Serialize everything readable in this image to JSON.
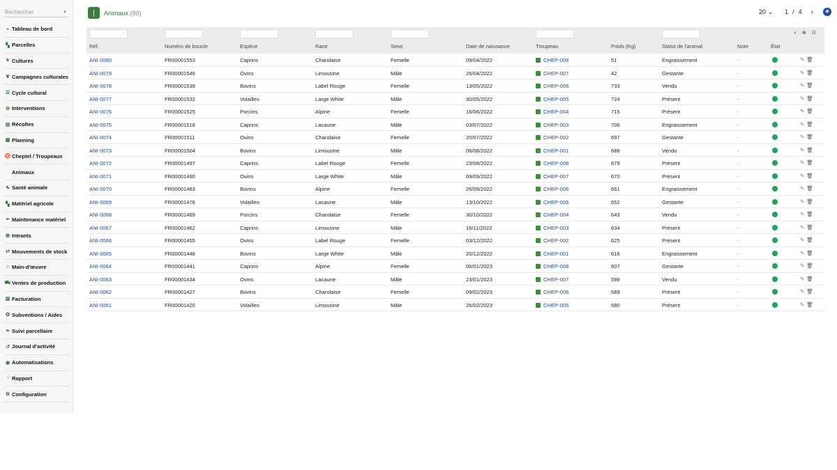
{
  "search": {
    "placeholder": "Rechercher"
  },
  "sidebar": {
    "items": [
      {
        "label": "Tableau de bord",
        "icon": "dashboard-icon",
        "glyph": "◒",
        "sub": false
      },
      {
        "label": "Parcelles",
        "icon": "tractor-icon",
        "glyph": "▚",
        "sub": false
      },
      {
        "label": "Cultures",
        "icon": "sprout-icon",
        "glyph": "⚘",
        "sub": false
      },
      {
        "label": "Campagnes culturales",
        "icon": "leaf-icon",
        "glyph": "❦",
        "sub": false
      },
      {
        "label": "Cycle cultural",
        "icon": "list-icon",
        "glyph": "☰",
        "sub": false
      },
      {
        "label": "Interventions",
        "icon": "bike-icon",
        "glyph": "⚙",
        "sub": false
      },
      {
        "label": "Récoltes",
        "icon": "basket-icon",
        "glyph": "▤",
        "sub": false
      },
      {
        "label": "Planning",
        "icon": "calendar-icon",
        "glyph": "▦",
        "sub": false
      },
      {
        "label": "Cheptel / Troupeaux",
        "icon": "cow-icon",
        "glyph": "♉",
        "sub": false
      },
      {
        "label": "Animaux",
        "icon": "",
        "glyph": "",
        "sub": true
      },
      {
        "label": "Santé animale",
        "icon": "syringe-icon",
        "glyph": "✎",
        "sub": false
      },
      {
        "label": "Matériel agricole",
        "icon": "tractor-icon",
        "glyph": "▚",
        "sub": false
      },
      {
        "label": "Maintenance matériel",
        "icon": "wrench-icon",
        "glyph": "✒",
        "sub": false
      },
      {
        "label": "Intrants",
        "icon": "sack-icon",
        "glyph": "◍",
        "sub": false
      },
      {
        "label": "Mouvements de stock",
        "icon": "exchange-icon",
        "glyph": "⇄",
        "sub": false
      },
      {
        "label": "Main-d'œuvre",
        "icon": "user-icon",
        "glyph": "☺",
        "sub": false
      },
      {
        "label": "Ventes de production",
        "icon": "truck-icon",
        "glyph": "⛟",
        "sub": false
      },
      {
        "label": "Facturation",
        "icon": "invoice-icon",
        "glyph": "▥",
        "sub": false
      },
      {
        "label": "Subventions / Aides",
        "icon": "award-icon",
        "glyph": "✪",
        "sub": false
      },
      {
        "label": "Suivi parcellaire",
        "icon": "map-icon",
        "glyph": "❧",
        "sub": false
      },
      {
        "label": "Journal d'activité",
        "icon": "history-icon",
        "glyph": "↺",
        "sub": false
      },
      {
        "label": "Automatisations",
        "icon": "robot-icon",
        "glyph": "◉",
        "sub": false
      },
      {
        "label": "Rapport",
        "icon": "chart-pie-icon",
        "glyph": "◔",
        "sub": false
      },
      {
        "label": "Configuration",
        "icon": "gear-icon",
        "glyph": "⚙",
        "sub": false
      }
    ]
  },
  "header": {
    "title": "Animaux",
    "count": "(80)"
  },
  "pager": {
    "page_size": "20",
    "current": "1",
    "sep": "/",
    "total": "4"
  },
  "table": {
    "columns": [
      "Réf.",
      "Numéro de boucle",
      "Espèce",
      "Race",
      "Sexe",
      "Date de naissance",
      "Troupeau",
      "Poids (Kg)",
      "Statut de l'animal",
      "Note",
      "État"
    ],
    "rows": [
      [
        "ANI-0080",
        "FR00001553",
        "Caprins",
        "Charolaise",
        "Femelle",
        "09/04/2022",
        "CHEP-008",
        "51",
        "Engraissement",
        "-"
      ],
      [
        "ANI-0079",
        "FR00001546",
        "Ovins",
        "Limousine",
        "Mâle",
        "26/04/2022",
        "CHEP-007",
        "42",
        "Gestante",
        "-"
      ],
      [
        "ANI-0078",
        "FR00001539",
        "Bovins",
        "Label Rouge",
        "Femelle",
        "13/05/2022",
        "CHEP-006",
        "733",
        "Vendu",
        "-"
      ],
      [
        "ANI-0077",
        "FR00001532",
        "Volailles",
        "Large White",
        "Mâle",
        "30/05/2022",
        "CHEP-005",
        "724",
        "Présent",
        "-"
      ],
      [
        "ANI-0076",
        "FR00001525",
        "Porcins",
        "Alpine",
        "Femelle",
        "16/06/2022",
        "CHEP-004",
        "715",
        "Présent",
        "-"
      ],
      [
        "ANI-0075",
        "FR00001518",
        "Caprins",
        "Lacaune",
        "Mâle",
        "03/07/2022",
        "CHEP-003",
        "706",
        "Engraissement",
        "-"
      ],
      [
        "ANI-0074",
        "FR00001511",
        "Ovins",
        "Charolaise",
        "Femelle",
        "20/07/2022",
        "CHEP-002",
        "697",
        "Gestante",
        "-"
      ],
      [
        "ANI-0073",
        "FR00001504",
        "Bovins",
        "Limousine",
        "Mâle",
        "06/08/2022",
        "CHEP-001",
        "688",
        "Vendu",
        "-"
      ],
      [
        "ANI-0072",
        "FR00001497",
        "Caprins",
        "Label Rouge",
        "Femelle",
        "23/08/2022",
        "CHEP-008",
        "679",
        "Présent",
        "-"
      ],
      [
        "ANI-0071",
        "FR00001490",
        "Ovins",
        "Large White",
        "Mâle",
        "09/09/2022",
        "CHEP-007",
        "670",
        "Présent",
        "-"
      ],
      [
        "ANI-0070",
        "FR00001483",
        "Bovins",
        "Alpine",
        "Femelle",
        "26/09/2022",
        "CHEP-006",
        "661",
        "Engraissement",
        "-"
      ],
      [
        "ANI-0069",
        "FR00001476",
        "Volailles",
        "Lacaune",
        "Mâle",
        "13/10/2022",
        "CHEP-005",
        "652",
        "Gestante",
        "-"
      ],
      [
        "ANI-0068",
        "FR00001469",
        "Porcins",
        "Charolaise",
        "Femelle",
        "30/10/2022",
        "CHEP-004",
        "643",
        "Vendu",
        "-"
      ],
      [
        "ANI-0067",
        "FR00001462",
        "Caprins",
        "Limousine",
        "Mâle",
        "16/11/2022",
        "CHEP-003",
        "634",
        "Présent",
        "-"
      ],
      [
        "ANI-0066",
        "FR00001455",
        "Ovins",
        "Label Rouge",
        "Femelle",
        "03/12/2022",
        "CHEP-002",
        "625",
        "Présent",
        "-"
      ],
      [
        "ANI-0065",
        "FR00001448",
        "Bovins",
        "Large White",
        "Mâle",
        "20/12/2022",
        "CHEP-001",
        "616",
        "Engraissement",
        "-"
      ],
      [
        "ANI-0064",
        "FR00001441",
        "Caprins",
        "Alpine",
        "Femelle",
        "06/01/2023",
        "CHEP-008",
        "607",
        "Gestante",
        "-"
      ],
      [
        "ANI-0063",
        "FR00001434",
        "Ovins",
        "Lacaune",
        "Mâle",
        "23/01/2023",
        "CHEP-007",
        "598",
        "Vendu",
        "-"
      ],
      [
        "ANI-0062",
        "FR00001427",
        "Bovins",
        "Charolaise",
        "Femelle",
        "09/02/2023",
        "CHEP-006",
        "589",
        "Présent",
        "-"
      ],
      [
        "ANI-0061",
        "FR00001420",
        "Volailles",
        "Limousine",
        "Mâle",
        "26/02/2023",
        "CHEP-005",
        "580",
        "Présent",
        "-"
      ]
    ]
  },
  "colors": {
    "accent": "#1b4aa8",
    "brand": "#3f7d3a",
    "status_ok": "#20a35a"
  }
}
